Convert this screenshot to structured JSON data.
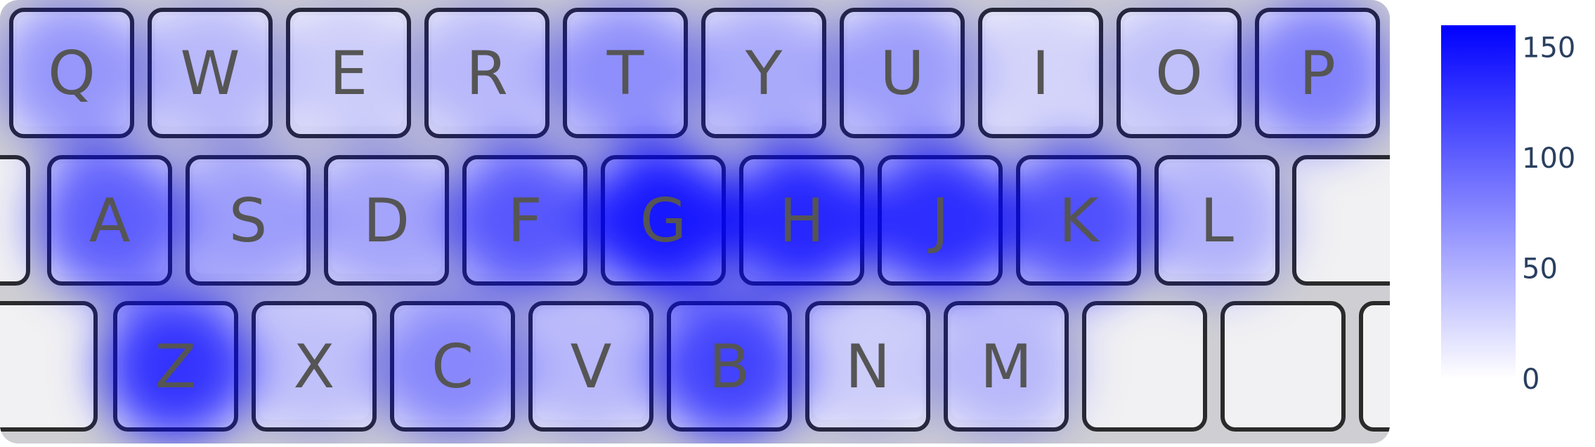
{
  "chart_data": {
    "type": "heatmap",
    "title": "",
    "xlabel": "",
    "ylabel": "",
    "background": "keyboard-image",
    "rows": [
      {
        "keys": [
          "Q",
          "W",
          "E",
          "R",
          "T",
          "Y",
          "U",
          "I",
          "O",
          "P"
        ],
        "values": [
          70,
          45,
          30,
          45,
          75,
          55,
          65,
          25,
          40,
          85
        ]
      },
      {
        "keys": [
          "A",
          "S",
          "D",
          "F",
          "G",
          "H",
          "J",
          "K",
          "L",
          ""
        ],
        "values": [
          110,
          65,
          60,
          115,
          160,
          150,
          145,
          120,
          50,
          0
        ]
      },
      {
        "keys": [
          "Z",
          "X",
          "C",
          "V",
          "B",
          "N",
          "M",
          "",
          "",
          ""
        ],
        "values": [
          140,
          40,
          80,
          45,
          130,
          30,
          45,
          0,
          0,
          0
        ]
      }
    ],
    "colorscale": {
      "range": [
        0,
        160
      ],
      "low_color": "#ffffff",
      "high_color": "#0000ff",
      "ticks": [
        {
          "value": 0,
          "label": "0"
        },
        {
          "value": 50,
          "label": "50"
        },
        {
          "value": 100,
          "label": "100"
        },
        {
          "value": 150,
          "label": "150"
        }
      ]
    },
    "colors": {
      "heat": "#0000ff",
      "key_face": "#f1f1f3",
      "key_border": "#2a2a2a",
      "key_text": "#555555",
      "tick_text": "#2a3f5f"
    }
  }
}
